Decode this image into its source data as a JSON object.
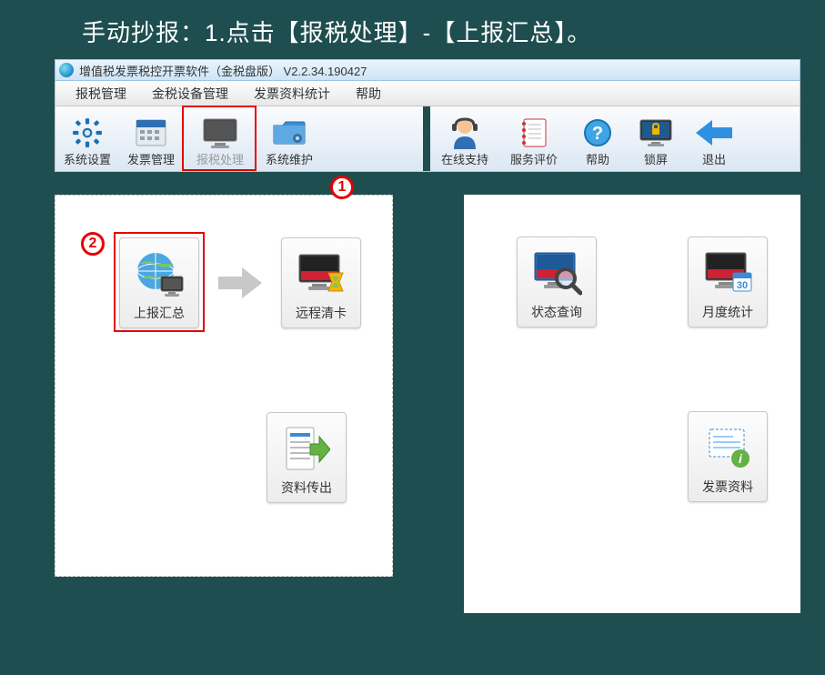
{
  "instruction_text": "手动抄报：1.点击【报税处理】-【上报汇总】。",
  "titlebar": {
    "text": "增值税发票税控开票软件（金税盘版）  V2.2.34.190427"
  },
  "menubar": {
    "items": [
      "报税管理",
      "金税设备管理",
      "发票资料统计",
      "帮助"
    ]
  },
  "toolbar_left": {
    "buttons": [
      {
        "label": "系统设置",
        "name": "system-settings-button"
      },
      {
        "label": "发票管理",
        "name": "invoice-management-button"
      },
      {
        "label": "报税处理",
        "name": "tax-processing-button"
      },
      {
        "label": "系统维护",
        "name": "system-maintenance-button"
      }
    ]
  },
  "toolbar_right": {
    "buttons": [
      {
        "label": "在线支持",
        "name": "online-support-button"
      },
      {
        "label": "服务评价",
        "name": "service-rating-button"
      },
      {
        "label": "帮助",
        "name": "help-button"
      },
      {
        "label": "锁屏",
        "name": "lock-screen-button"
      },
      {
        "label": "退出",
        "name": "exit-button"
      }
    ]
  },
  "callouts": {
    "one": "1",
    "two": "2"
  },
  "tiles": {
    "left_top_a": "上报汇总",
    "left_top_b": "远程清卡",
    "left_bottom": "资料传出",
    "right_top_a": "状态查询",
    "right_top_b": "月度统计",
    "right_bottom": "发票资料"
  }
}
